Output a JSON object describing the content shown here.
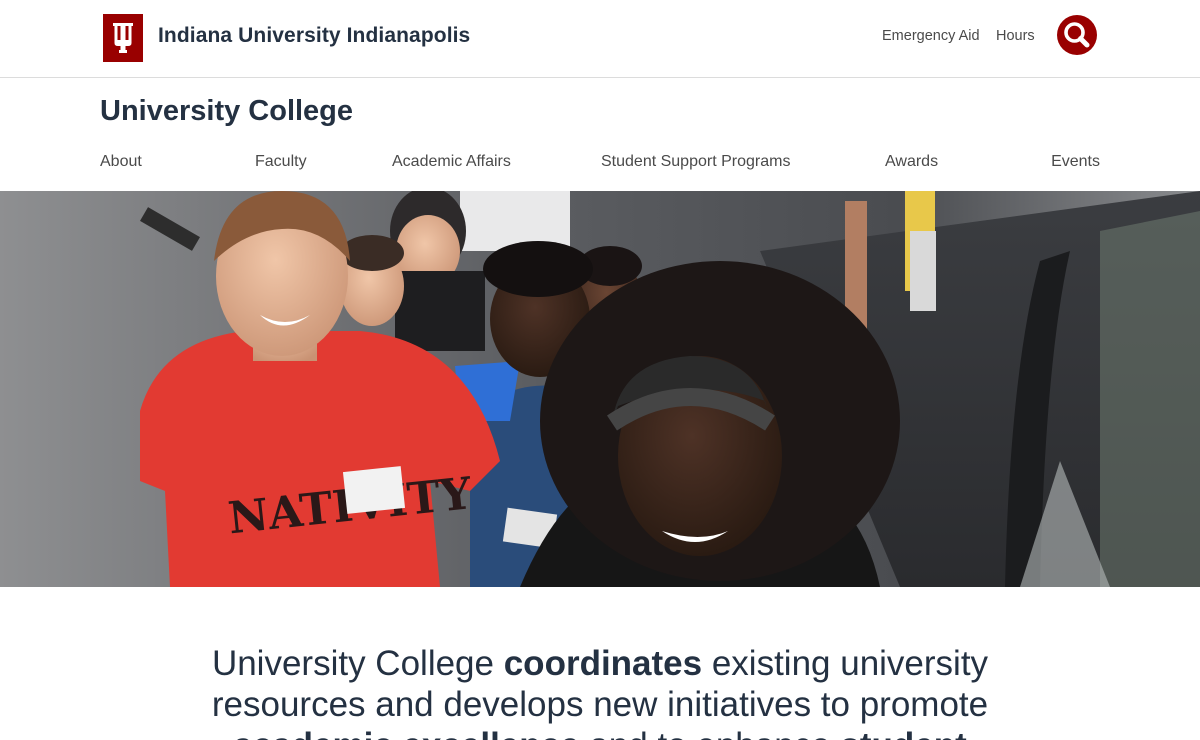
{
  "header": {
    "university_name": "Indiana University Indianapolis",
    "emergency_link": "Emergency Aid",
    "hours_link": "Hours",
    "brand_color": "#990000",
    "logo_icon": "iu-trident-icon",
    "search_icon": "search-icon"
  },
  "site": {
    "title": "University College"
  },
  "nav": {
    "items": [
      "About",
      "Faculty",
      "Academic Affairs",
      "Student Support Programs",
      "Awards",
      "Events"
    ]
  },
  "hero": {
    "image_icon": "students-on-escalator-photo",
    "badge_text": "NATIVITY"
  },
  "intro": {
    "p1": "University College ",
    "b1": "coordinates",
    "p2": " existing university resources and develops new initiatives to promote ",
    "b2": "academic excellence",
    "p3": " and to enhance ",
    "b3": "student"
  }
}
